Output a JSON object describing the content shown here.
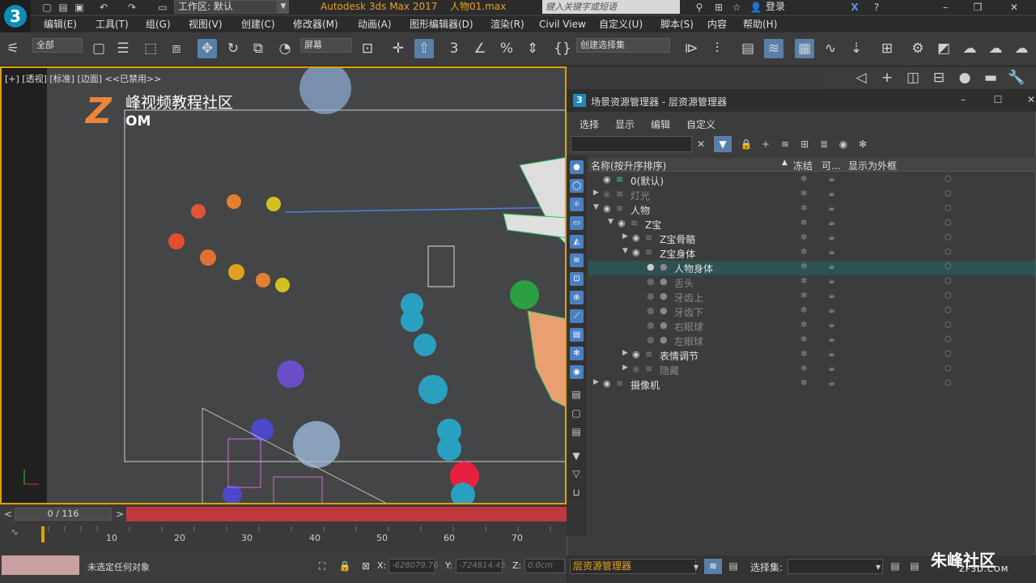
{
  "titlebar": {
    "workspace": "工作区: 默认",
    "app_title": "Autodesk 3ds Max 2017",
    "file_title": "人物01.max",
    "search_placeholder": "键入关键字或短语",
    "login": "登录"
  },
  "menu": [
    "编辑(E)",
    "工具(T)",
    "组(G)",
    "视图(V)",
    "创建(C)",
    "修改器(M)",
    "动画(A)",
    "图形编辑器(D)",
    "渲染(R)",
    "Civil View",
    "自定义(U)",
    "脚本(S)",
    "内容",
    "帮助(H)"
  ],
  "toolbar": {
    "filter_select": "全部",
    "ref_coord": "屏幕",
    "named_sel": "创建选择集"
  },
  "viewport": {
    "label": "[+] [透视] [标准] [边面] <<已禁用>>"
  },
  "watermark": {
    "text": "峰视频教程社区",
    "suffix": "OM",
    "corner": "朱峰社区",
    "corner_url": "ZF3D.COM"
  },
  "explorer": {
    "title": "场景资源管理器 - 层资源管理器",
    "menu": [
      "选择",
      "显示",
      "编辑",
      "自定义"
    ],
    "headers": {
      "name": "名称(按升序排序)",
      "freeze": "冻结",
      "render": "可...",
      "box": "显示为外框"
    },
    "rows": [
      {
        "label": "0(默认)",
        "indent": 0,
        "dim": false
      },
      {
        "label": "灯光",
        "indent": 0,
        "dim": true
      },
      {
        "label": "人物",
        "indent": 0,
        "dim": false
      },
      {
        "label": "Z宝",
        "indent": 1,
        "dim": false
      },
      {
        "label": "Z宝骨骼",
        "indent": 2,
        "dim": false
      },
      {
        "label": "Z宝身体",
        "indent": 2,
        "dim": false
      },
      {
        "label": "人物身体",
        "indent": 3,
        "dim": false
      },
      {
        "label": "舌头",
        "indent": 3,
        "dim": true
      },
      {
        "label": "牙齿上",
        "indent": 3,
        "dim": true
      },
      {
        "label": "牙齿下",
        "indent": 3,
        "dim": true
      },
      {
        "label": "右眼球",
        "indent": 3,
        "dim": true
      },
      {
        "label": "左眼球",
        "indent": 3,
        "dim": true
      },
      {
        "label": "表情调节",
        "indent": 2,
        "dim": false
      },
      {
        "label": "隐藏",
        "indent": 2,
        "dim": true
      },
      {
        "label": "摄像机",
        "indent": 0,
        "dim": false
      }
    ],
    "footer_layer": "层资源管理器",
    "footer_sel_label": "选择集:"
  },
  "timeline": {
    "frame": "0 / 116",
    "ticks": [
      "10",
      "20",
      "30",
      "40",
      "50",
      "60",
      "70"
    ]
  },
  "status": {
    "text": "未选定任何对象",
    "x": "-628079.76",
    "y": "-724814.45",
    "z_label": "Z:",
    "z": "0.0cm"
  }
}
